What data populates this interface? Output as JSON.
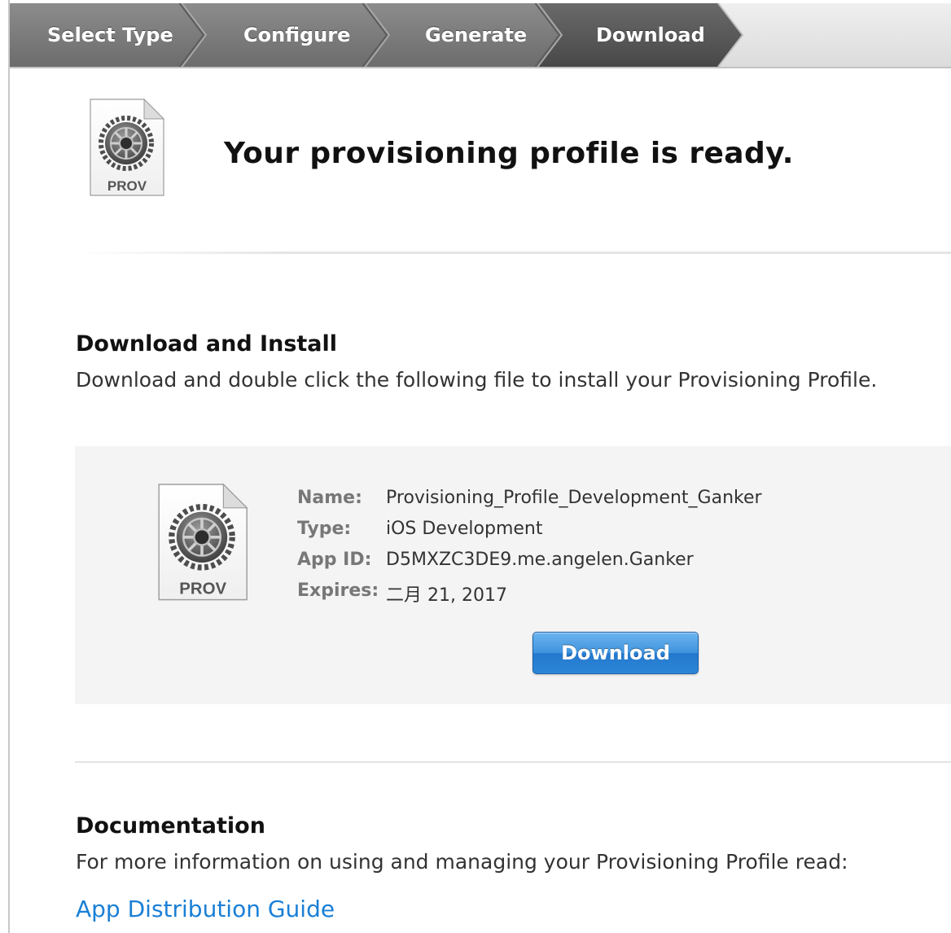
{
  "steps": {
    "items": [
      {
        "label": "Select Type"
      },
      {
        "label": "Configure"
      },
      {
        "label": "Generate"
      },
      {
        "label": "Download",
        "active": true
      }
    ],
    "colors": {
      "completed": "#7b7b7b",
      "active": "#555555"
    }
  },
  "header": {
    "title": "Your provisioning profile is ready.",
    "icon": {
      "name": "prov-file-icon",
      "label": "PROV"
    }
  },
  "install": {
    "title": "Download and Install",
    "description": "Download and double click the following file to install your Provisioning Profile."
  },
  "profile": {
    "icon_label": "PROV",
    "name_label": "Name:",
    "name": "Provisioning_Profile_Development_Ganker",
    "type_label": "Type:",
    "type": "iOS Development",
    "app_id_label": "App ID:",
    "app_id": "D5MXZC3DE9.me.angelen.Ganker",
    "expires_label": "Expires:",
    "expires": "二月 21, 2017",
    "download_label": "Download"
  },
  "documentation": {
    "title": "Documentation",
    "description": "For more information on using and managing your Provisioning Profile read:",
    "link": "App Distribution Guide"
  },
  "colors": {
    "accent": "#2e86d8",
    "link": "#1a7fd6",
    "panel_bg": "#f4f4f4"
  }
}
